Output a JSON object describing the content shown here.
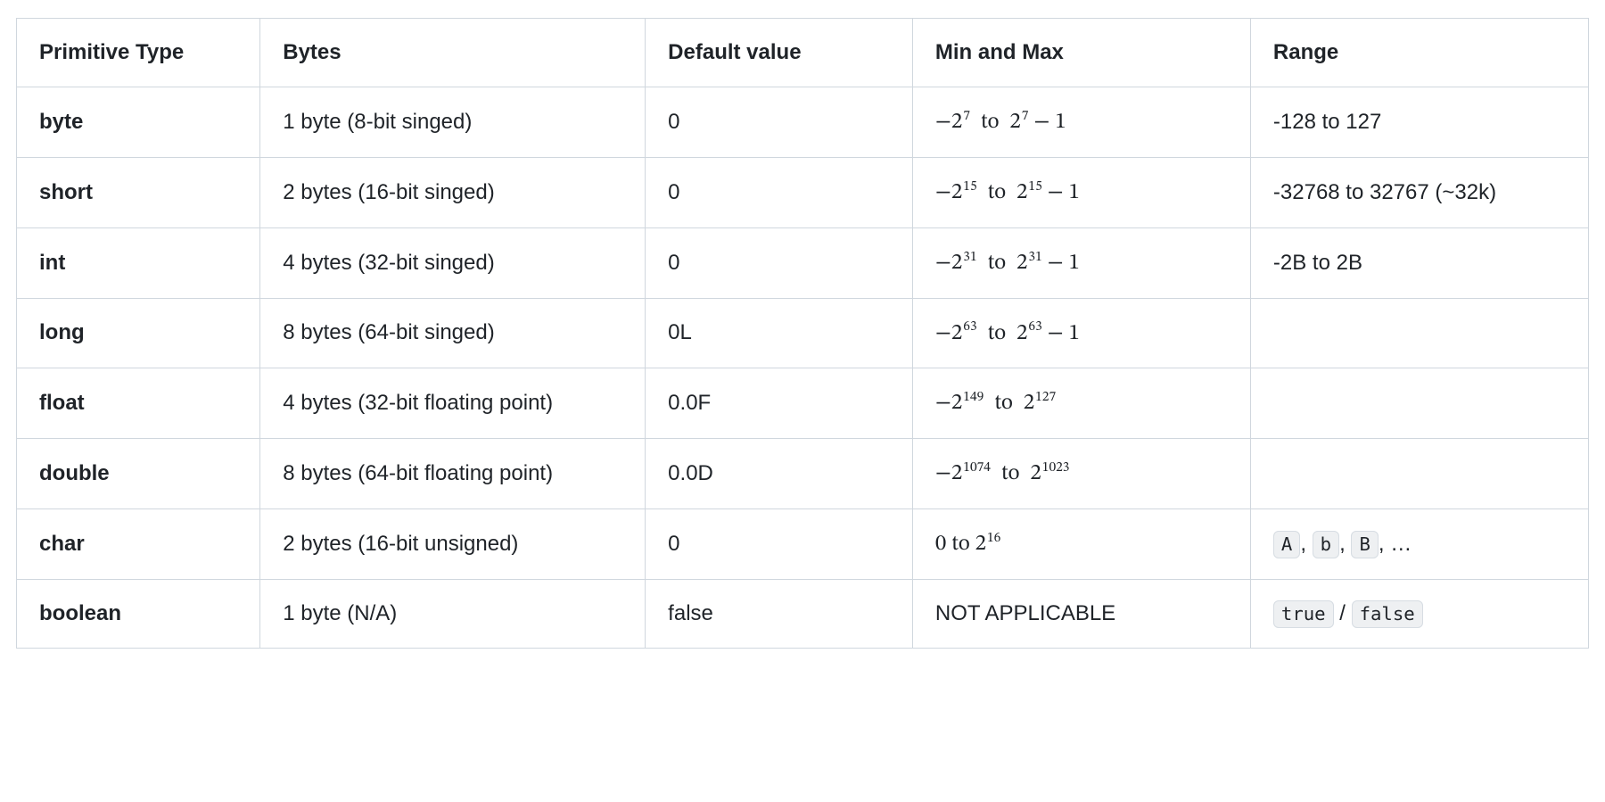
{
  "table": {
    "headers": {
      "type": "Primitive Type",
      "bytes": "Bytes",
      "default": "Default value",
      "minmax": "Min and Max",
      "range": "Range"
    },
    "rows": [
      {
        "type": "byte",
        "bytes": "1 byte (8-bit singed)",
        "default": "0",
        "minmax": {
          "neg_exp": "7",
          "to": "to",
          "pos_exp": "7",
          "trail": " − 1"
        },
        "range": {
          "kind": "text",
          "text": "-128 to 127"
        }
      },
      {
        "type": "short",
        "bytes": "2 bytes (16-bit singed)",
        "default": "0",
        "minmax": {
          "neg_exp": "15",
          "to": "to",
          "pos_exp": "15",
          "trail": " − 1"
        },
        "range": {
          "kind": "text",
          "text": "-32768 to 32767 (~32k)"
        }
      },
      {
        "type": "int",
        "bytes": "4 bytes (32-bit singed)",
        "default": "0",
        "minmax": {
          "neg_exp": "31",
          "to": "to",
          "pos_exp": "31",
          "trail": " − 1"
        },
        "range": {
          "kind": "text",
          "text": "-2B to 2B"
        }
      },
      {
        "type": "long",
        "bytes": "8 bytes (64-bit singed)",
        "default": "0L",
        "minmax": {
          "neg_exp": "63",
          "to": "to",
          "pos_exp": "63",
          "trail": " − 1"
        },
        "range": {
          "kind": "text",
          "text": ""
        }
      },
      {
        "type": "float",
        "bytes": "4 bytes (32-bit floating point)",
        "default": "0.0F",
        "minmax": {
          "neg_exp": "149",
          "to": "to",
          "pos_exp": "127",
          "trail": ""
        },
        "range": {
          "kind": "text",
          "text": ""
        }
      },
      {
        "type": "double",
        "bytes": "8 bytes (64-bit floating point)",
        "default": "0.0D",
        "minmax": {
          "neg_exp": "1074",
          "to": "to",
          "pos_exp": "1023",
          "trail": ""
        },
        "range": {
          "kind": "text",
          "text": ""
        }
      },
      {
        "type": "char",
        "bytes": "2 bytes (16-bit unsigned)",
        "default": "0",
        "minmax": {
          "zero_to": "0 to ",
          "pos_exp": "16"
        },
        "range": {
          "kind": "chars",
          "chars": [
            "A",
            "b",
            "B"
          ],
          "sep": ", ",
          "trail": ", …"
        }
      },
      {
        "type": "boolean",
        "bytes": "1 byte (N/A)",
        "default": "false",
        "minmax": {
          "text": "NOT APPLICABLE"
        },
        "range": {
          "kind": "bools",
          "t": "true",
          "f": "false",
          "sep": "  /  "
        }
      }
    ]
  }
}
